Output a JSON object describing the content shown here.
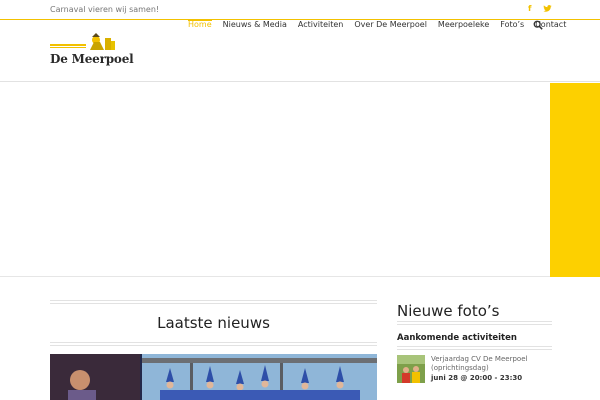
{
  "topbar": {
    "tagline": "Carnaval vieren wij samen!",
    "social": [
      "facebook-icon",
      "twitter-icon"
    ]
  },
  "header": {
    "logo_text": "De Meerpoel",
    "nav": [
      {
        "label": "Home",
        "active": true
      },
      {
        "label": "Nieuws & Media",
        "active": false
      },
      {
        "label": "Activiteiten",
        "active": false
      },
      {
        "label": "Over De Meerpoel",
        "active": false
      },
      {
        "label": "Meerpoeleke",
        "active": false
      },
      {
        "label": "Foto’s",
        "active": false
      },
      {
        "label": "Contact",
        "active": false
      }
    ],
    "search_icon": "search-icon"
  },
  "colors": {
    "accent": "#f2c100",
    "hero_panel": "#fdd000"
  },
  "main": {
    "news_title": "Laatste nieuws"
  },
  "sidebar": {
    "photos_title": "Nieuwe foto’s",
    "events_title": "Aankomende activiteiten",
    "events": [
      {
        "name": "Verjaardag CV De Meerpoel (oprichtingsdag)",
        "time": "juni 28 @ 20:00 - 23:30"
      }
    ]
  }
}
